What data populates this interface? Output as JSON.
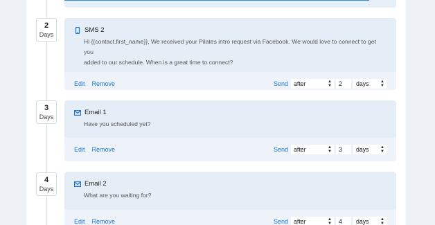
{
  "steps": [
    {
      "day": "2",
      "day_unit": "Days",
      "title": "SMS 2",
      "icon": "phone-icon",
      "body_line1": "Hi {{contact.first_name}}, We received your Pilates intro request via Facebook.  We would love to connect to get you",
      "body_line2": "added to our schedule.  When is a great time to connect?",
      "edit": "Edit",
      "remove": "Remove",
      "send_label": "Send",
      "when": "after",
      "amount": "2",
      "unit": "days"
    },
    {
      "day": "3",
      "day_unit": "Days",
      "title": "Email 1",
      "icon": "mail-icon",
      "body_line1": "Have you scheduled yet?",
      "edit": "Edit",
      "remove": "Remove",
      "send_label": "Send",
      "when": "after",
      "amount": "3",
      "unit": "days"
    },
    {
      "day": "4",
      "day_unit": "Days",
      "title": "Email 2",
      "icon": "mail-icon",
      "body_line1": "What are you waiting for?",
      "edit": "Edit",
      "remove": "Remove",
      "send_label": "Send",
      "when": "after",
      "amount": "4",
      "unit": "days"
    }
  ],
  "colors": {
    "accent": "#1f78d1",
    "card_bg": "#e5eef7",
    "footer_bg": "#eef3f9"
  }
}
